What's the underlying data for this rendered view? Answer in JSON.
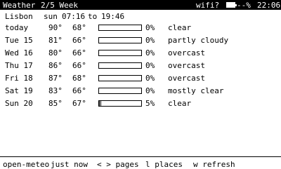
{
  "header": {
    "app_title": "Weather",
    "page_label": "2/5 Week",
    "wifi_label": "wifi?",
    "battery_icon": "battery-icon",
    "battery_text": "--%",
    "clock": "22:06"
  },
  "location": {
    "name": "Lisbon",
    "sun_prefix": "sun",
    "sunrise": "07:16",
    "to_word": "to",
    "sunset": "19:46"
  },
  "forecast": [
    {
      "day": "today",
      "hi": "90°",
      "lo": "68°",
      "precip_pct": "0%",
      "precip_fraction": 0.0,
      "condition": "clear"
    },
    {
      "day": "Tue 15",
      "hi": "81°",
      "lo": "66°",
      "precip_pct": "0%",
      "precip_fraction": 0.0,
      "condition": "partly cloudy"
    },
    {
      "day": "Wed 16",
      "hi": "80°",
      "lo": "66°",
      "precip_pct": "0%",
      "precip_fraction": 0.0,
      "condition": "overcast"
    },
    {
      "day": "Thu 17",
      "hi": "86°",
      "lo": "66°",
      "precip_pct": "0%",
      "precip_fraction": 0.0,
      "condition": "overcast"
    },
    {
      "day": "Fri 18",
      "hi": "87°",
      "lo": "68°",
      "precip_pct": "0%",
      "precip_fraction": 0.0,
      "condition": "overcast"
    },
    {
      "day": "Sat 19",
      "hi": "83°",
      "lo": "66°",
      "precip_pct": "0%",
      "precip_fraction": 0.0,
      "condition": "mostly clear"
    },
    {
      "day": "Sun 20",
      "hi": "85°",
      "lo": "67°",
      "precip_pct": "5%",
      "precip_fraction": 0.05,
      "condition": "clear"
    }
  ],
  "footer": {
    "source": "open-meteo",
    "freshness": "just now",
    "pages_hint": "< > pages",
    "places_hint": "l places",
    "refresh_hint": "w refresh"
  }
}
